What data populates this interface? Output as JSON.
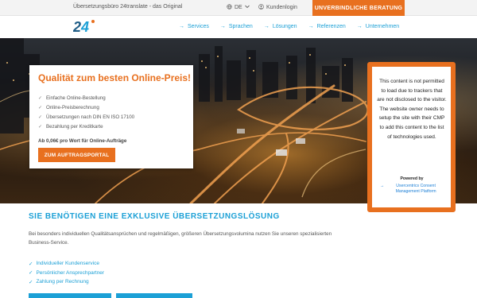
{
  "topbar": {
    "tagline": "Übersetzungsbüro 24translate - das Original",
    "language": "DE",
    "login": "Kundenlogin",
    "cta": "UNVERBINDLICHE BERATUNG"
  },
  "logo": {
    "text": "24",
    "alt": "24translate logo"
  },
  "nav": [
    {
      "label": "Services"
    },
    {
      "label": "Sprachen"
    },
    {
      "label": "Lösungen"
    },
    {
      "label": "Referenzen"
    },
    {
      "label": "Unternehmen"
    }
  ],
  "promo": {
    "title": "Qualität zum besten Online-Preis!",
    "features": [
      "Einfache Online-Bestellung",
      "Online-Preisberechnung",
      "Übersetzungen nach DIN EN ISO 17100",
      "Bezahlung per Kreditkarte"
    ],
    "price": "Ab 0,06€ pro Wort für Online-Aufträge",
    "button": "ZUM AUFTRAGSPORTAL"
  },
  "consent": {
    "message": "This content is not permitted to load due to trackers that are not disclosed to the visitor. The website owner needs to setup the site with their CMP to add this content to the list of technologies used.",
    "powered_by": "Powered by",
    "cmp_link": "Usercentrics Consent Management Platform"
  },
  "section": {
    "title": "SIE BENÖTIGEN EINE EXKLUSIVE ÜBERSETZUNGSLÖSUNG",
    "text": "Bei besonders individuellen Qualitätsansprüchen und regelmäßigen, größeren Übersetzungsvolumina nutzen Sie unseren spezialisierten Business-Service.",
    "benefits": [
      "Individueller Kundenservice",
      "Persönlicher Ansprechpartner",
      "Zahlung per Rechnung"
    ]
  },
  "colors": {
    "accent": "#e8701f",
    "brand_blue": "#1ca0d6"
  },
  "icons": {
    "language": "globe-icon",
    "login": "user-icon",
    "check": "check-icon",
    "nav_arrow": "arrow-right-icon"
  }
}
